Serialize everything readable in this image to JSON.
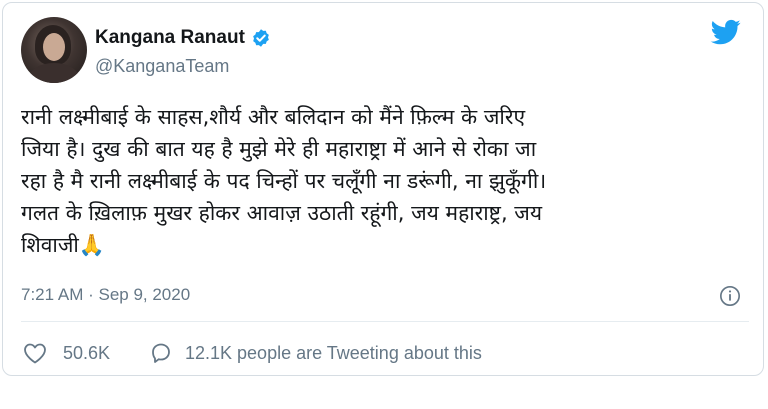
{
  "author": {
    "name": "Kangana Ranaut",
    "handle": "@KanganaTeam"
  },
  "tweet": {
    "text": "रानी लक्ष्मीबाई के साहस,शौर्य और बलिदान को मैंने फ़िल्म के जरिए\nजिया है। दुख की बात यह है मुझे मेरे ही महाराष्ट्रा में आने से रोका जा\nरहा है मै रानी लक्ष्मीबाई के पद चिन्हों पर चलूँगी ना डरूंगी, ना झुकूँगी।\nगलत के ख़िलाफ़ मुखर होकर आवाज़ उठाती रहूंगी, जय महाराष्ट्र, जय\nशिवाजी🙏",
    "timestamp": "7:21 AM · Sep 9, 2020"
  },
  "stats": {
    "likes": "50.6K",
    "conversation": "12.1K people are Tweeting about this"
  },
  "colors": {
    "twitter_blue": "#1da1f2",
    "secondary_text": "#657786",
    "primary_text": "#14171a"
  },
  "icons": {
    "verified": "verified-badge-icon",
    "logo": "twitter-bird-icon",
    "info": "info-icon",
    "like": "heart-icon",
    "reply": "speech-bubble-icon"
  }
}
